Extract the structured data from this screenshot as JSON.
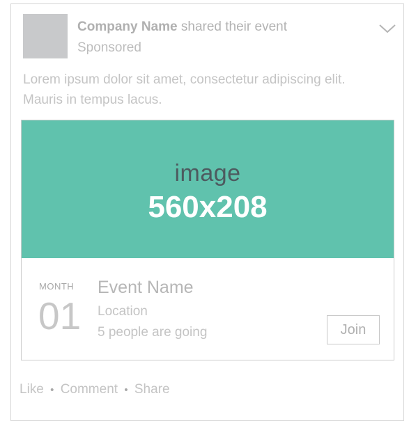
{
  "post": {
    "company": "Company Name",
    "action_text": " shared their event",
    "sponsored": "Sponsored",
    "body": "Lorem ipsum dolor sit amet, consectetur adipiscing elit. Mauris in tempus lacus.",
    "menu_icon": "chevron-down-icon"
  },
  "hero": {
    "word": "image",
    "size": "560x208",
    "bg_color": "#60c2ad"
  },
  "event": {
    "month": "MONTH",
    "day": "01",
    "name": "Event Name",
    "location": "Location",
    "attendance": "5 people are going",
    "join_label": "Join"
  },
  "actions": {
    "like": "Like",
    "comment": "Comment",
    "share": "Share",
    "separator": "•"
  }
}
